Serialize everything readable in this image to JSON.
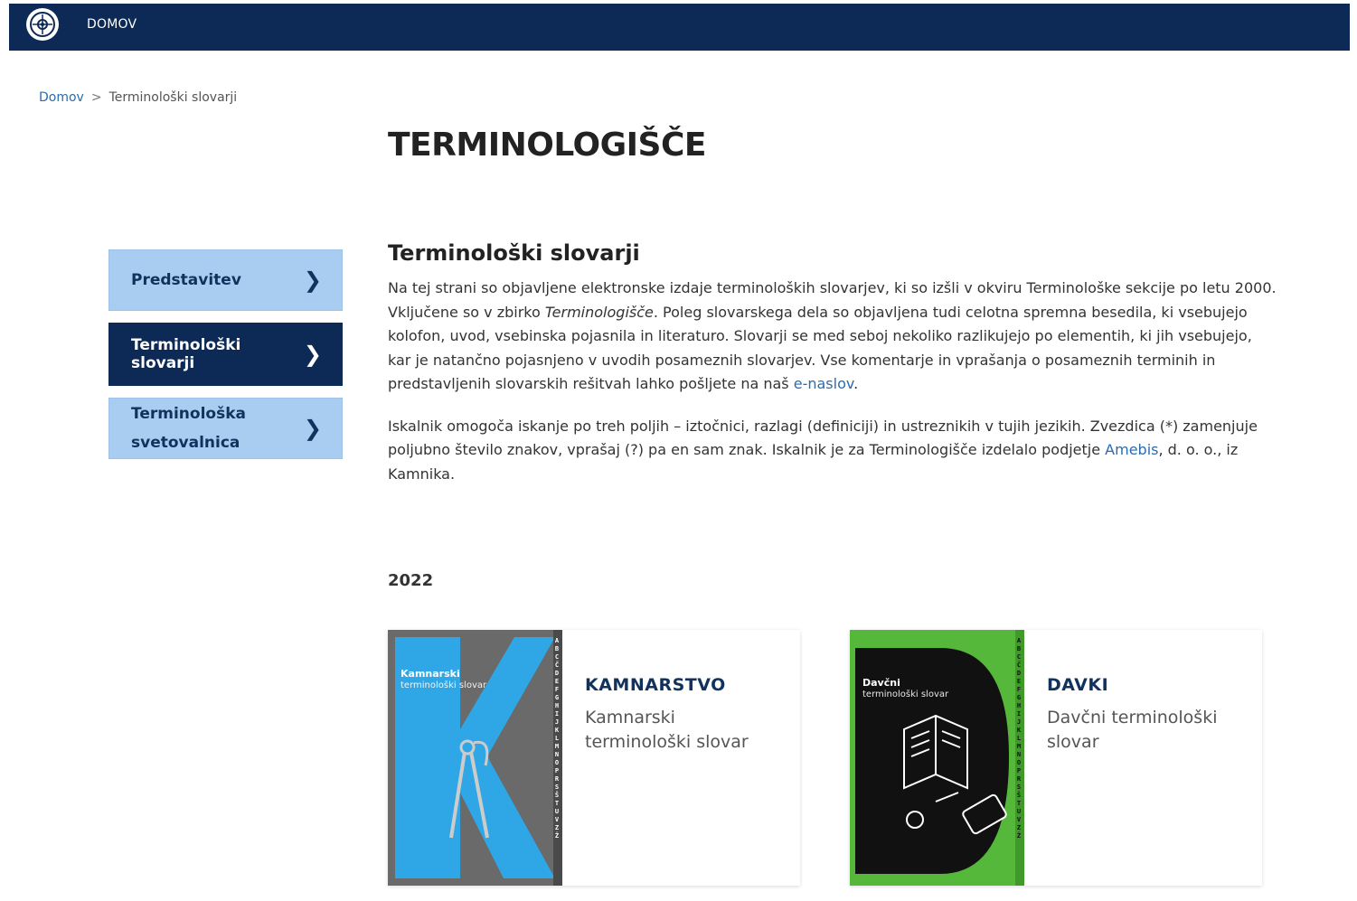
{
  "header": {
    "nav_label": "DOMOV"
  },
  "breadcrumb": {
    "home": "Domov",
    "separator": ">",
    "current": "Terminološki slovarji"
  },
  "page": {
    "title": "TERMINOLOGIŠČE"
  },
  "sidebar": {
    "items": [
      {
        "label": "Predstavitev",
        "active": false
      },
      {
        "label": "Terminološki slovarji",
        "active": true
      },
      {
        "label_line1": "Terminološka",
        "label_line2": "svetovalnica",
        "active": false
      }
    ],
    "chevron": "❯"
  },
  "main": {
    "heading": "Terminološki slovarji",
    "p1_part1": "Na tej strani so objavljene elektronske izdaje terminoloških slovarjev, ki so izšli v okviru Terminološke sekcije po letu 2000. Vključene so v zbirko ",
    "p1_italic": "Terminologišče",
    "p1_part2": ". Poleg slovarskega dela so objavljena tudi celotna spremna besedila, ki vsebujejo kolofon, uvod, vsebinska pojasnila in literaturo. Slovarji se med seboj nekoliko razlikujejo po elementih, ki jih vsebujejo, kar je natančno pojasnjeno v uvodih posameznih slovarjev. Vse komentarje in vprašanja o posameznih terminih in predstavljenih slovarskih rešitvah lahko pošljete na naš ",
    "p1_link": "e-naslov",
    "p1_end": ".",
    "p2_part1": "Iskalnik omogoča iskanje po treh poljih – iztočnici, razlagi (definiciji) in ustreznikih v tujih jezikih. Zvezdica (*) zamenjuje poljubno število znakov, vprašaj (?) pa en sam znak. Iskalnik je za Terminologišče izdelalo podjetje ",
    "p2_link": "Amebis",
    "p2_end": ", d. o. o., iz Kamnika."
  },
  "year": "2022",
  "cards": [
    {
      "title": "KAMNARSTVO",
      "subtitle": "Kamnarski terminološki slovar",
      "cover_title": "Kamnarski",
      "cover_subtitle": "terminološki slovar",
      "cover_letter": "K",
      "spine": "ABCČDEFGHIJKLMNOPRSŠTUVZŽ",
      "colors": {
        "bg": "#6b6b6b",
        "accent": "#29a8e8"
      }
    },
    {
      "title": "DAVKI",
      "subtitle": "Davčni terminološki slovar",
      "cover_title": "Davčni",
      "cover_subtitle": "terminološki slovar",
      "cover_letter": "D",
      "spine": "ABCČDEFGHIJKLMNOPRSŠTUVZŽ",
      "colors": {
        "bg": "#55b83a",
        "accent": "#111111"
      }
    }
  ],
  "colors": {
    "navy": "#0c2a55",
    "sidebar_light": "#a8cdf0",
    "link": "#2b6cb0"
  }
}
